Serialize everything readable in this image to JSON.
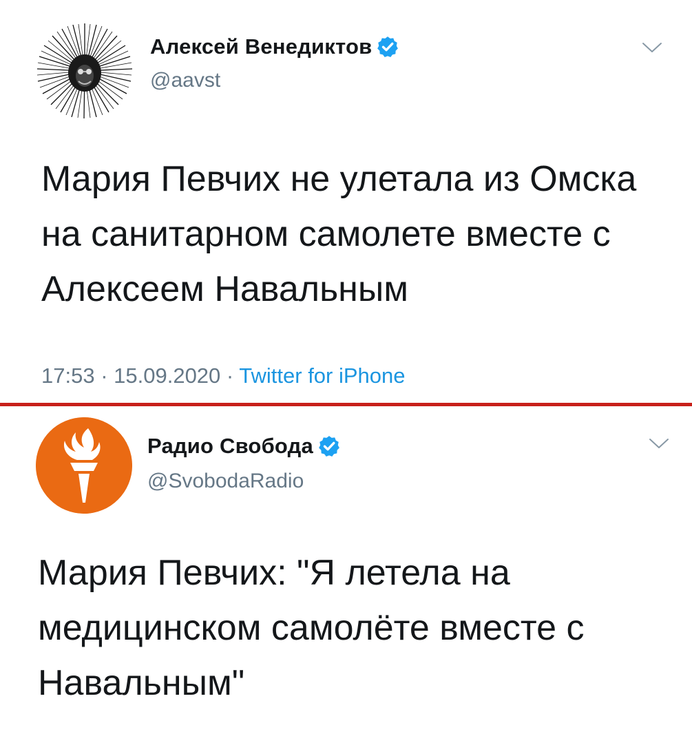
{
  "tweets": [
    {
      "author_name": "Алексей Венедиктов",
      "handle": "@aavst",
      "text_lines": [
        "Мария Певчих не улетала из Омска",
        "на санитарном самолете вместе с",
        "Алексеем Навальным"
      ],
      "time": "17:53",
      "date": "15.09.2020",
      "source": "Twitter for iPhone",
      "verified": true,
      "avatar_icon": "portrait-etching-icon"
    },
    {
      "author_name": "Радио Свобода",
      "handle": "@SvobodaRadio",
      "text_lines": [
        "Мария Певчих: \"Я летела на",
        "медицинском самолёте вместе с",
        "Навальным\""
      ],
      "verified": true,
      "avatar_icon": "torch-logo-icon"
    }
  ],
  "meta_separator": " · ",
  "colors": {
    "verified_blue": "#1da1f2",
    "divider_red": "#c8201a",
    "logo_orange": "#ea6a13",
    "secondary_text": "#657786",
    "link_blue": "#1b95e0"
  }
}
